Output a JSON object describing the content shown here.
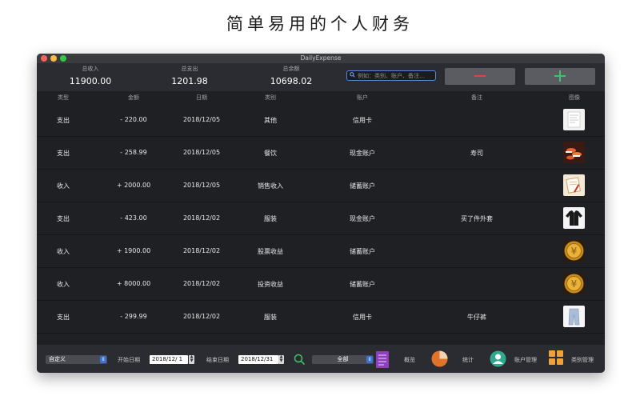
{
  "headline": "简单易用的个人财务",
  "window": {
    "title": "DailyExpense"
  },
  "summary": {
    "income_label": "总收入",
    "income_value": "11900.00",
    "expense_label": "总支出",
    "expense_value": "1201.98",
    "balance_label": "总余额",
    "balance_value": "10698.02",
    "search_placeholder": "例如：类别、账户、备注…"
  },
  "columns": {
    "type": "类型",
    "amount": "金额",
    "date": "日期",
    "category": "类别",
    "account": "账户",
    "note": "备注",
    "image": "图像"
  },
  "rows": [
    {
      "type": "支出",
      "amount": "- 220.00",
      "date": "2018/12/05",
      "category": "其他",
      "account": "信用卡",
      "note": "",
      "image": "receipt-image"
    },
    {
      "type": "支出",
      "amount": "- 258.99",
      "date": "2018/12/05",
      "category": "餐饮",
      "account": "现金账户",
      "note": "寿司",
      "image": "sushi-image"
    },
    {
      "type": "收入",
      "amount": "+ 2000.00",
      "date": "2018/12/05",
      "category": "销售收入",
      "account": "储蓄账户",
      "note": "",
      "image": "notebook-image"
    },
    {
      "type": "支出",
      "amount": "- 423.00",
      "date": "2018/12/02",
      "category": "服装",
      "account": "现金账户",
      "note": "买了件外套",
      "image": "jacket-image"
    },
    {
      "type": "收入",
      "amount": "+ 1900.00",
      "date": "2018/12/02",
      "category": "股票收益",
      "account": "储蓄账户",
      "note": "",
      "image": "gold-coin-image"
    },
    {
      "type": "收入",
      "amount": "+ 8000.00",
      "date": "2018/12/02",
      "category": "投资收益",
      "account": "储蓄账户",
      "note": "",
      "image": "gold-coin-image"
    },
    {
      "type": "支出",
      "amount": "- 299.99",
      "date": "2018/12/02",
      "category": "服装",
      "account": "信用卡",
      "note": "牛仔裤",
      "image": "jeans-image"
    }
  ],
  "footer": {
    "range_select": "自定义",
    "start_label": "开始日期",
    "start_value": "2018/12/ 1",
    "end_label": "结束日期",
    "end_value": "2018/12/31",
    "filter_select": "全部",
    "overview_label": "概览",
    "stats_label": "统计",
    "accounts_label": "账户管理",
    "categories_label": "类别管理"
  },
  "colors": {
    "background": "#1f2024",
    "panel": "#2a2c31",
    "minus": "#e0433a",
    "plus": "#3cc46a",
    "accent": "#3b73d6"
  }
}
